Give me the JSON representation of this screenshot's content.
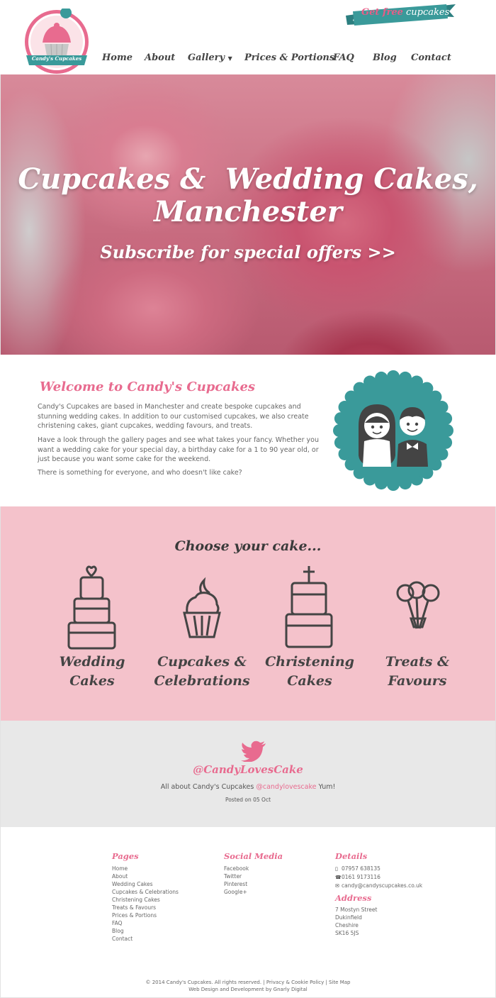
{
  "header": {
    "logo_text": "Candy's Cupcakes",
    "cta": {
      "part1": "Get free",
      "part2": "cupcakes"
    },
    "nav": [
      {
        "label": "Home"
      },
      {
        "label": "About"
      },
      {
        "label": "Gallery"
      },
      {
        "label": "Prices & Portions"
      },
      {
        "label": "FAQ"
      },
      {
        "label": "Blog"
      },
      {
        "label": "Contact"
      }
    ]
  },
  "hero": {
    "title_line1": "Cupcakes &  Wedding Cakes,",
    "title_line2": "Manchester",
    "subscribe": "Subscribe for special offers >>"
  },
  "welcome": {
    "title": "Welcome to Candy's Cupcakes",
    "p1": "Candy's Cupcakes are based in Manchester and create bespoke cupcakes and stunning wedding cakes. In addition to our customised cupcakes, we also create christening cakes, giant cupcakes, wedding favours, and treats.",
    "p2": "Have a look through the gallery pages and see what takes your fancy. Whether you want a wedding cake for your special day, a birthday cake for a 1 to 90 year old, or just because you want some cake for the weekend.",
    "p3": "There is something for everyone, and who doesn't like cake?"
  },
  "choose": {
    "title": "Choose your cake...",
    "items": [
      {
        "line1": "Wedding",
        "line2": "Cakes",
        "icon": "wedding-cake-icon"
      },
      {
        "line1": "Cupcakes &",
        "line2": "Celebrations",
        "icon": "cupcake-icon"
      },
      {
        "line1": "Christening",
        "line2": "Cakes",
        "icon": "christening-cake-icon"
      },
      {
        "line1": "Treats &",
        "line2": "Favours",
        "icon": "cake-pops-icon"
      }
    ]
  },
  "twitter": {
    "handle": "@CandyLovesCake",
    "tweet_before": "All about Candy's Cupcakes ",
    "tweet_link": "@candylovescake",
    "tweet_after": " Yum!",
    "posted": "Posted on 05 Oct"
  },
  "footer": {
    "pages_title": "Pages",
    "pages": [
      "Home",
      "About",
      "Wedding Cakes",
      "Cupcakes & Celebrations",
      "Christening Cakes",
      "Treats & Favours",
      "Prices & Portions",
      "FAQ",
      "Blog",
      "Contact"
    ],
    "social_title": "Social Media",
    "social": [
      "Facebook",
      "Twitter",
      "Pinterest",
      "Google+"
    ],
    "details_title": "Details",
    "mobile": "07957 638135",
    "phone": "0161 9173116",
    "email": "candy@candyscupcakes.co.uk",
    "address_title": "Address",
    "address": [
      "7 Mostyn Street",
      "Dukinfield",
      "Cheshire",
      "SK16 5JS"
    ],
    "copyright": "© 2014 Candy's Cupcakes. All rights reserved. | Privacy & Cookie Policy | Site Map",
    "credit": "Web Design and Development by Gnarly Digital"
  },
  "colors": {
    "pink_accent": "#e86b8f",
    "teal": "#3a9a9a",
    "choose_bg": "#f4c2cb",
    "twitter_bg": "#e8e8e8"
  }
}
